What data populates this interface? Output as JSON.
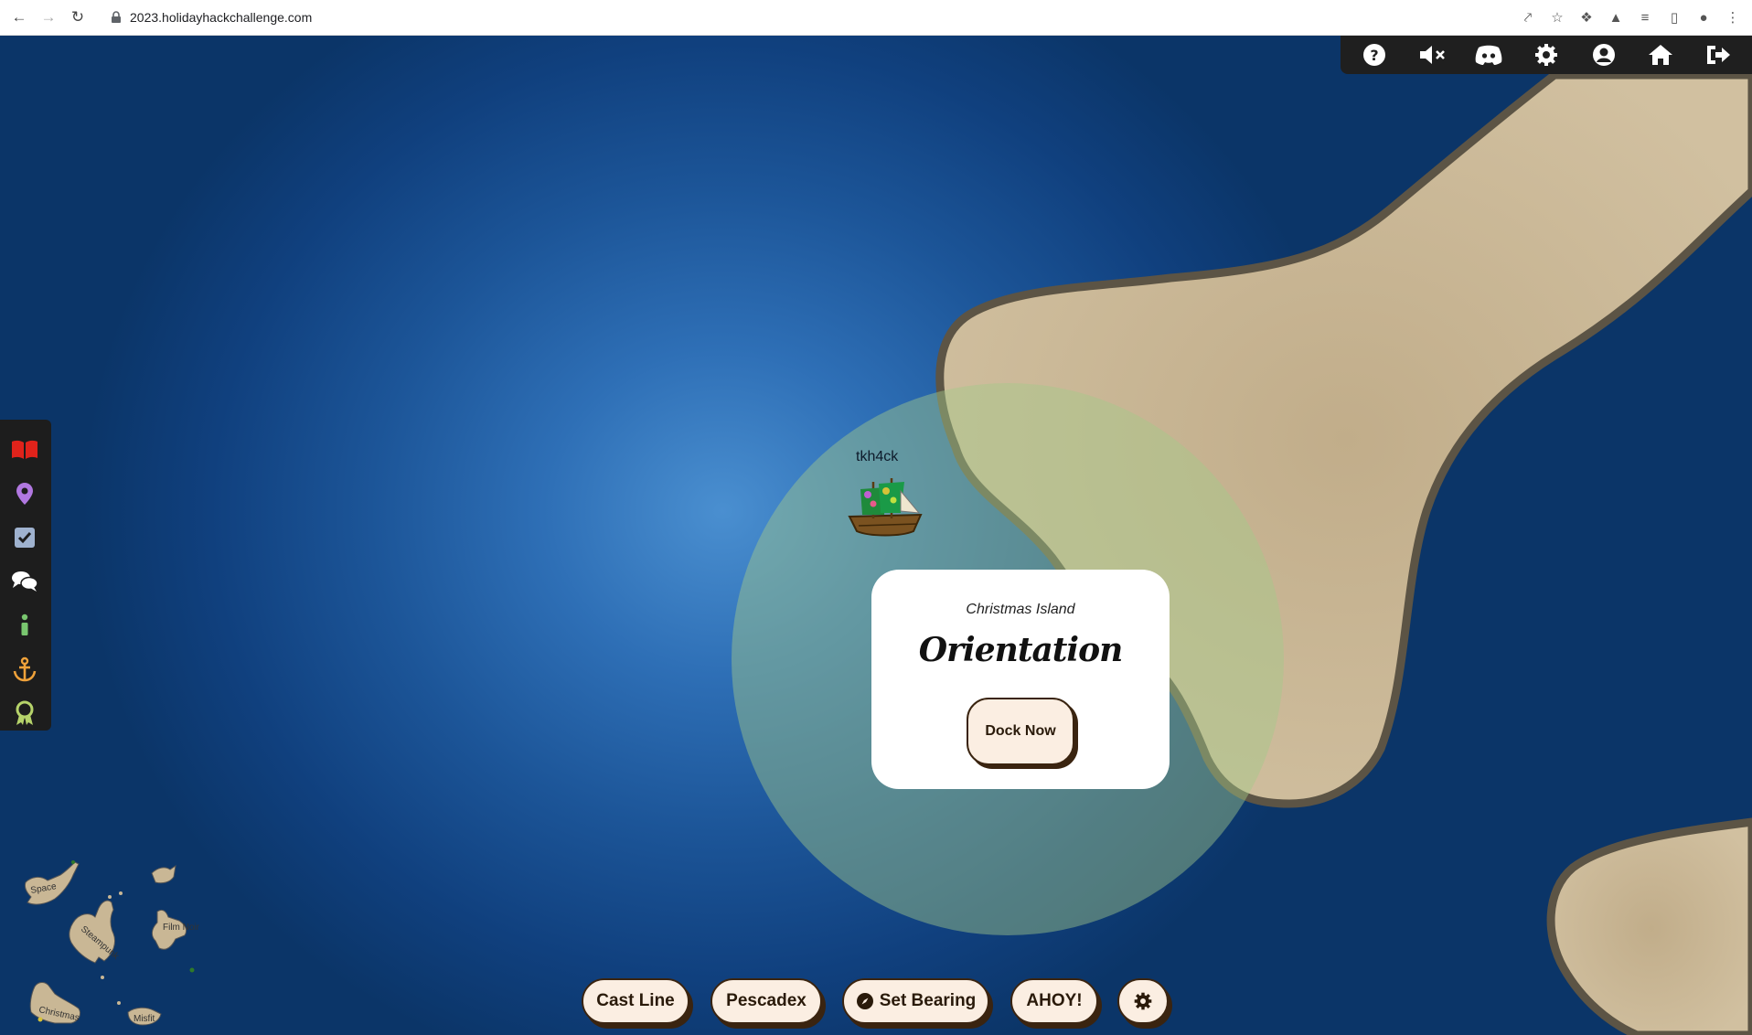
{
  "browser": {
    "url": "2023.holidayhackchallenge.com"
  },
  "top_toolbar": {
    "icons": [
      "help-icon",
      "mute-icon",
      "discord-icon",
      "settings-icon",
      "profile-icon",
      "home-icon",
      "logout-icon"
    ]
  },
  "sidebar": {
    "icons": [
      "badge-book-icon",
      "location-pin-icon",
      "objectives-check-icon",
      "chat-icon",
      "info-icon",
      "anchor-icon",
      "achievements-icon"
    ]
  },
  "player": {
    "name": "tkh4ck"
  },
  "dock_popup": {
    "island": "Christmas Island",
    "location": "Orientation",
    "button_label": "Dock Now"
  },
  "controls": {
    "cast_line": "Cast Line",
    "pescadex": "Pescadex",
    "set_bearing": "Set Bearing",
    "ahoy": "AHOY!"
  },
  "minimap": {
    "islands": [
      "Space",
      "Steampunk",
      "Film Noir",
      "Christmas",
      "Misfit"
    ]
  },
  "colors": {
    "ocean": "#1c5598",
    "sand": "#c9b795",
    "button_bg": "#fbeee2",
    "button_border": "#3a2410"
  }
}
